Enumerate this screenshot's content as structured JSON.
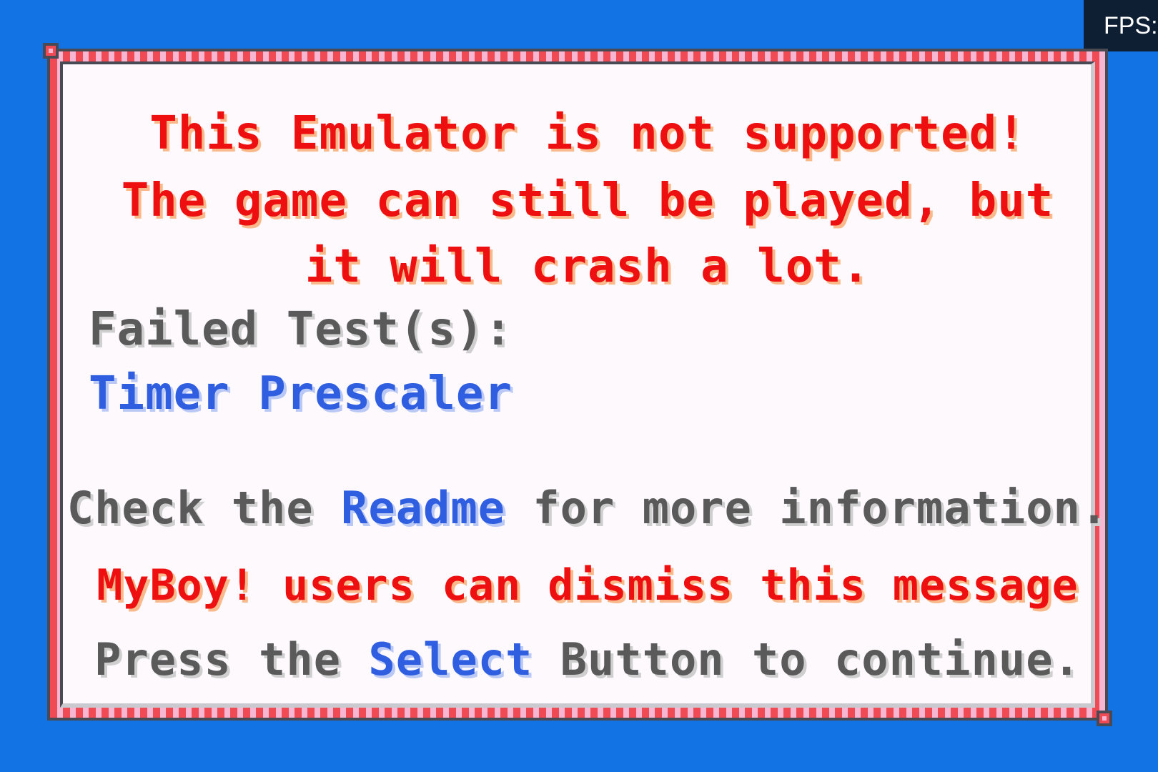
{
  "overlay": {
    "fps_label": "FPS:"
  },
  "dialog": {
    "warning_lines": [
      "This Emulator is not supported!",
      "The game can still be played, but",
      "it will crash a lot."
    ],
    "failed_label": "Failed Test(s):",
    "failed_tests": [
      "Timer Prescaler"
    ],
    "readme": {
      "pre": "Check the ",
      "link": "Readme",
      "post": " for more information."
    },
    "myboy_notice": "MyBoy! users can dismiss this message",
    "continue": {
      "pre": "Press the ",
      "button": "Select",
      "post": " Button to continue."
    }
  },
  "colors": {
    "background": "#1273e4",
    "dialog_fill": "#fdf9fd",
    "border_red": "#f04a55",
    "border_pink": "#f7b7d3",
    "warning_text": "#ee1010",
    "normal_text": "#5a5a5a",
    "highlight_text": "#2f5fe0"
  }
}
